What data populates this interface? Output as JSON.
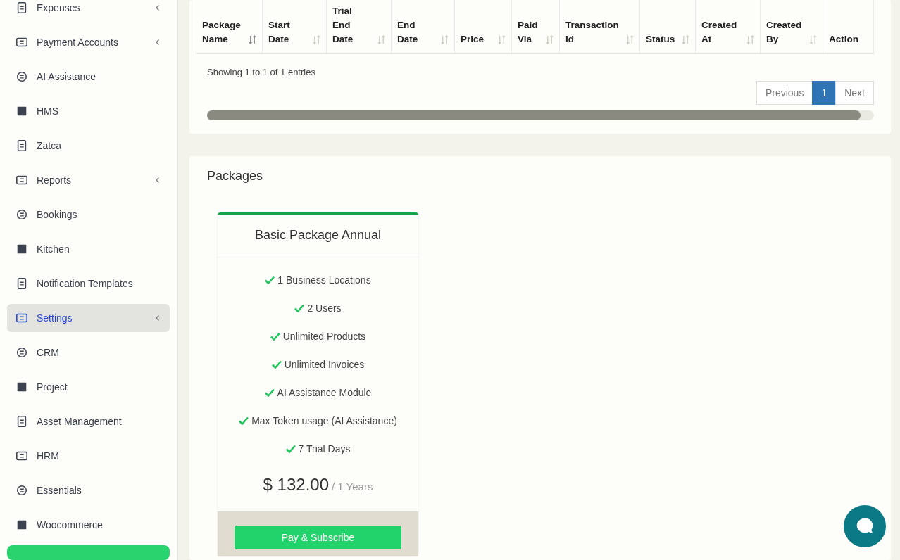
{
  "sidebar": {
    "items": [
      {
        "label": "Expenses",
        "expandable": true,
        "selected": false
      },
      {
        "label": "Payment Accounts",
        "expandable": true,
        "selected": false
      },
      {
        "label": "AI Assistance",
        "expandable": false,
        "selected": false
      },
      {
        "label": "HMS",
        "expandable": false,
        "selected": false
      },
      {
        "label": "Zatca",
        "expandable": false,
        "selected": false
      },
      {
        "label": "Reports",
        "expandable": true,
        "selected": false
      },
      {
        "label": "Bookings",
        "expandable": false,
        "selected": false
      },
      {
        "label": "Kitchen",
        "expandable": false,
        "selected": false
      },
      {
        "label": "Notification Templates",
        "expandable": false,
        "selected": false
      },
      {
        "label": "Settings",
        "expandable": true,
        "selected": true
      },
      {
        "label": "CRM",
        "expandable": false,
        "selected": false
      },
      {
        "label": "Project",
        "expandable": false,
        "selected": false
      },
      {
        "label": "Asset Management",
        "expandable": false,
        "selected": false
      },
      {
        "label": "HRM",
        "expandable": false,
        "selected": false
      },
      {
        "label": "Essentials",
        "expandable": false,
        "selected": false
      },
      {
        "label": "Woocommerce",
        "expandable": false,
        "selected": false
      }
    ]
  },
  "subscriptions_table": {
    "columns": [
      {
        "lines": [
          "Package",
          "Name"
        ],
        "sortable": true,
        "sorted": true
      },
      {
        "lines": [
          "Start",
          "Date"
        ],
        "sortable": true,
        "sorted": false
      },
      {
        "lines": [
          "Trial",
          "End",
          "Date"
        ],
        "sortable": true,
        "sorted": false
      },
      {
        "lines": [
          "End",
          "Date"
        ],
        "sortable": true,
        "sorted": false
      },
      {
        "lines": [
          "Price"
        ],
        "sortable": true,
        "sorted": false
      },
      {
        "lines": [
          "Paid",
          "Via"
        ],
        "sortable": true,
        "sorted": false
      },
      {
        "lines": [
          "Transaction",
          "Id"
        ],
        "sortable": true,
        "sorted": false
      },
      {
        "lines": [
          "Status"
        ],
        "sortable": true,
        "sorted": false
      },
      {
        "lines": [
          "Created",
          "At"
        ],
        "sortable": true,
        "sorted": false
      },
      {
        "lines": [
          "Created",
          "By"
        ],
        "sortable": true,
        "sorted": false
      },
      {
        "lines": [
          "Action"
        ],
        "sortable": false
      }
    ],
    "info": "Showing 1 to 1 of 1 entries",
    "pagination": [
      {
        "label": "Previous",
        "selected": false
      },
      {
        "label": "1",
        "selected": true
      },
      {
        "label": "Next",
        "selected": false
      }
    ]
  },
  "packages": {
    "title": "Packages",
    "cards": [
      {
        "name": "Basic Package Annual",
        "features": [
          "1 Business Locations",
          "2 Users",
          "Unlimited Products",
          "Unlimited Invoices",
          "AI Assistance Module",
          "Max Token usage (AI Assistance)",
          "7 Trial Days"
        ],
        "price": "$ 132.00",
        "period": "/ 1 Years",
        "button": "Pay & Subscribe"
      }
    ]
  }
}
